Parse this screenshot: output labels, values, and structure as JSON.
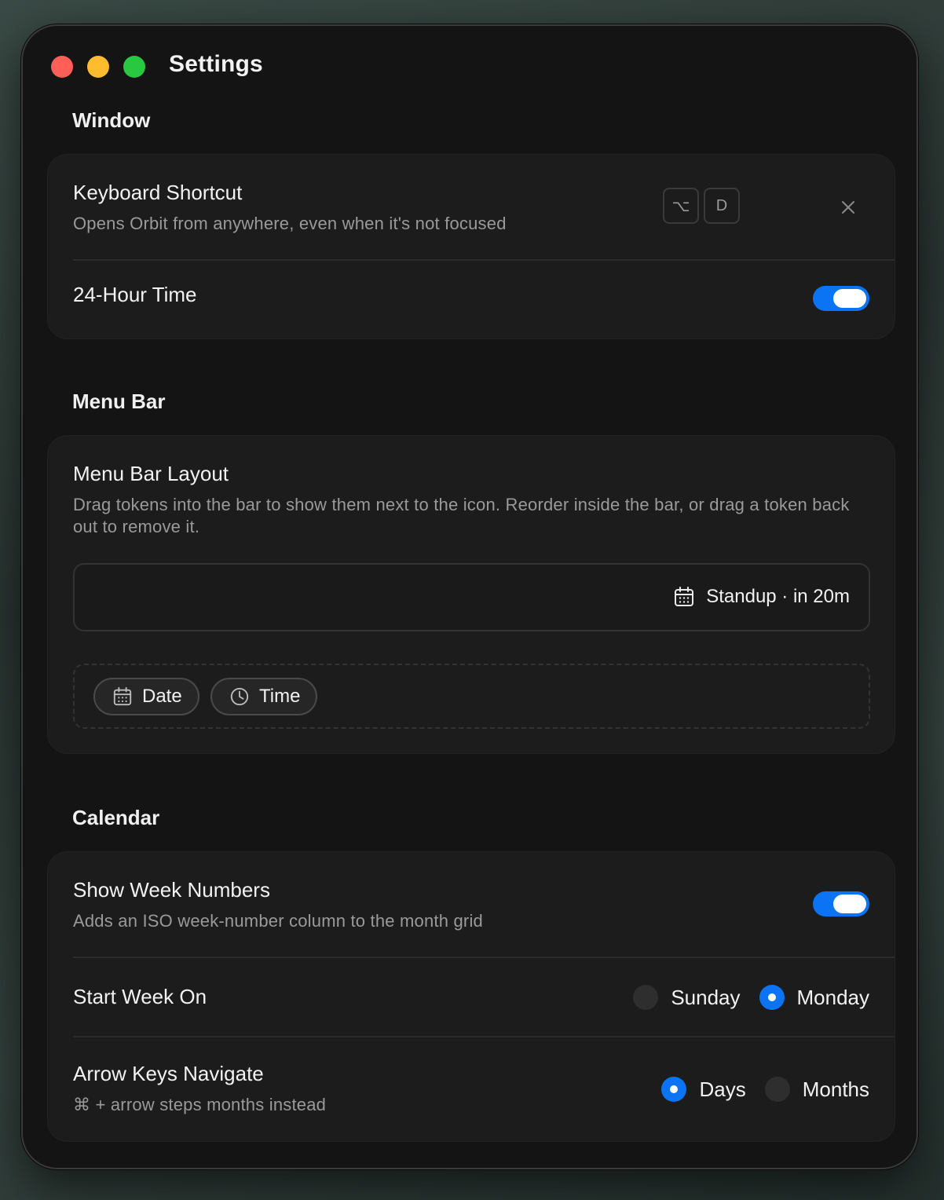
{
  "window": {
    "title": "Settings"
  },
  "sections": {
    "window": {
      "header": "Window",
      "keyboard_shortcut": {
        "title": "Keyboard Shortcut",
        "subtitle": "Opens Orbit from anywhere, even when it's not focused",
        "keys": [
          "⌥",
          "D"
        ],
        "clear_icon": "close-icon"
      },
      "twenty_four_hour": {
        "title": "24-Hour Time",
        "enabled": true
      }
    },
    "menu_bar": {
      "header": "Menu Bar",
      "layout": {
        "title": "Menu Bar Layout",
        "subtitle": "Drag tokens into the bar to show them next to the icon. Reorder inside the bar, or drag a token back out to remove it.",
        "bar_tokens": [
          {
            "icon": "calendar-icon",
            "label": "Standup · in 20m"
          }
        ],
        "available_tokens": [
          {
            "icon": "calendar-icon",
            "label": "Date"
          },
          {
            "icon": "clock-icon",
            "label": "Time"
          }
        ]
      }
    },
    "calendar": {
      "header": "Calendar",
      "week_numbers": {
        "title": "Show Week Numbers",
        "subtitle": "Adds an ISO week-number column to the month grid",
        "enabled": true
      },
      "start_week": {
        "title": "Start Week On",
        "options": [
          "Sunday",
          "Monday"
        ],
        "selected": "Monday"
      },
      "arrow_keys": {
        "title": "Arrow Keys Navigate",
        "subtitle": "⌘ + arrow steps months instead",
        "options": [
          "Days",
          "Months"
        ],
        "selected": "Days"
      }
    }
  },
  "colors": {
    "accent": "#0a74f5",
    "traffic_close": "#ff5f57",
    "traffic_min": "#febc2e",
    "traffic_max": "#28c840"
  }
}
